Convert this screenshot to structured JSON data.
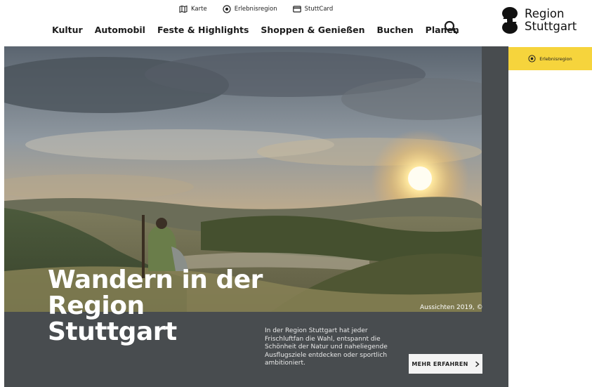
{
  "utility_nav": [
    {
      "label": "Karte",
      "icon": "map-icon"
    },
    {
      "label": "Erlebnisregion",
      "icon": "target-icon"
    },
    {
      "label": "StuttCard",
      "icon": "card-icon"
    }
  ],
  "main_nav": [
    {
      "label": "Kultur"
    },
    {
      "label": "Automobil"
    },
    {
      "label": "Feste & Highlights"
    },
    {
      "label": "Shoppen & Genießen"
    },
    {
      "label": "Buchen"
    },
    {
      "label": "Planen"
    }
  ],
  "search": {
    "icon": "search-icon"
  },
  "logo": {
    "line1": "Region",
    "line2": "Stuttgart"
  },
  "hero": {
    "title_lines": [
      "Wandern in der",
      "Region",
      "Stuttgart"
    ],
    "credit": "Aussichten 2019, ©",
    "text": "In der Region Stuttgart hat jeder Frischluftfan die Wahl, entspannt die Schönheit der Natur und naheliegende Ausflugsziele entdecken oder sportlich ambitioniert.",
    "cta_label": "MEHR ERFAHREN"
  },
  "side_tab": {
    "label": "Erlebnisregion",
    "icon": "target-icon"
  },
  "colors": {
    "accent_yellow": "#f6d43c",
    "hero_panel": "#484c4f"
  }
}
